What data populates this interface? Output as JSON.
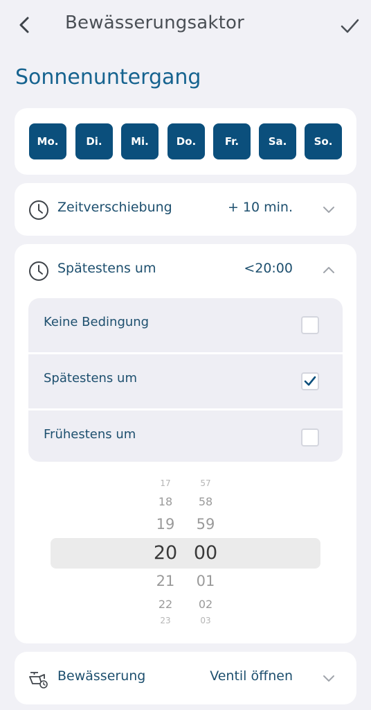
{
  "header": {
    "title": "Bewässerungsaktor"
  },
  "page_heading": "Sonnenuntergang",
  "days": [
    "Mo.",
    "Di.",
    "Mi.",
    "Do.",
    "Fr.",
    "Sa.",
    "So."
  ],
  "time_shift": {
    "label": "Zeitverschiebung",
    "value": "+ 10 min."
  },
  "latest": {
    "label": "Spätestens um",
    "value": "<20:00",
    "options": [
      {
        "label": "Keine Bedingung",
        "checked": false
      },
      {
        "label": "Spätestens um",
        "checked": true
      },
      {
        "label": "Frühestens um",
        "checked": false
      }
    ]
  },
  "time_picker": {
    "hours": [
      "17",
      "18",
      "19",
      "20",
      "21",
      "22",
      "23"
    ],
    "minutes": [
      "57",
      "58",
      "59",
      "00",
      "01",
      "02",
      "03"
    ],
    "selected_hour": "20",
    "selected_minute": "00"
  },
  "irrigation": {
    "label": "Bewässerung",
    "value": "Ventil öffnen"
  },
  "colors": {
    "accent": "#0b4f7c",
    "heading": "#16638f",
    "background": "#f1f1f6"
  }
}
